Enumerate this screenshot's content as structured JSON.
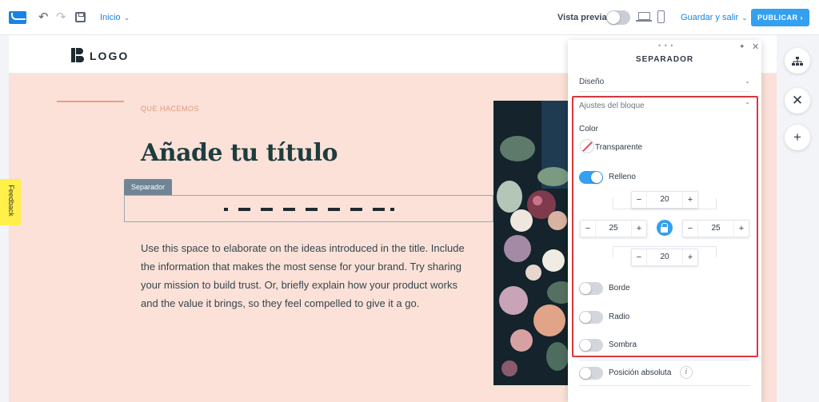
{
  "topbar": {
    "undo_icon": "undo-icon",
    "redo_icon": "redo-icon",
    "page_select": "Inicio",
    "preview_label": "Vista previa",
    "save_exit": "Guardar y salir",
    "publish": "PUBLICAR",
    "accent_color": "#34a0f0"
  },
  "site": {
    "logo_text": "LOGO",
    "eyebrow": "QUE HACEMOS",
    "headline": "Añade tu título",
    "separator_tag": "Separador",
    "body": "Use this space to elaborate on the ideas introduced in the title. Include the information that makes the most sense for your brand. Try sharing your mission to build trust. Or, briefly explain how your product works and the value it brings, so they feel compelled to give it a go."
  },
  "feedback": {
    "label": "Feedback"
  },
  "panel": {
    "grip": "• • •",
    "title": "SEPARADOR",
    "design_section": "Diseño",
    "block_section": "Ajustes del bloque",
    "color_label": "Color",
    "color_value": "Transparente",
    "padding_toggle": {
      "label": "Relleno",
      "on": true
    },
    "padding": {
      "top": "20",
      "left": "25",
      "right": "25",
      "bottom": "20"
    },
    "border_toggle": {
      "label": "Borde",
      "on": false
    },
    "radius_toggle": {
      "label": "Radio",
      "on": false
    },
    "shadow_toggle": {
      "label": "Sombra",
      "on": false
    },
    "absolute_toggle": {
      "label": "Posición absoluta",
      "on": false
    },
    "highlight_color": "#d9363e"
  }
}
